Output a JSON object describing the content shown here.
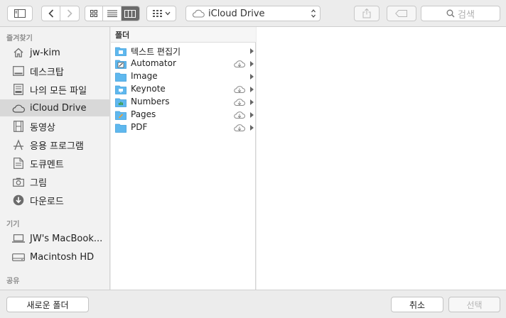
{
  "toolbar": {
    "path_label": "iCloud Drive",
    "search_placeholder": "검색"
  },
  "sidebar": {
    "sections": [
      {
        "label": "즐겨찾기"
      },
      {
        "label": "기기"
      },
      {
        "label": "공유"
      }
    ],
    "favorites": [
      {
        "label": "jw-kim",
        "icon": "home-icon"
      },
      {
        "label": "데스크탑",
        "icon": "desktop-icon"
      },
      {
        "label": "나의 모든 파일",
        "icon": "all-files-icon"
      },
      {
        "label": "iCloud Drive",
        "icon": "cloud-icon",
        "selected": true
      },
      {
        "label": "동영상",
        "icon": "film-icon"
      },
      {
        "label": "응용 프로그램",
        "icon": "applications-icon"
      },
      {
        "label": "도큐멘트",
        "icon": "document-icon"
      },
      {
        "label": "그림",
        "icon": "camera-icon"
      },
      {
        "label": "다운로드",
        "icon": "download-icon"
      }
    ],
    "devices": [
      {
        "label": "JW's MacBook...",
        "icon": "laptop-icon"
      },
      {
        "label": "Macintosh HD",
        "icon": "disk-icon"
      }
    ]
  },
  "column": {
    "header": "폴더",
    "items": [
      {
        "name": "텍스트 편집기",
        "cloud": false
      },
      {
        "name": "Automator",
        "cloud": true
      },
      {
        "name": "Image",
        "cloud": false
      },
      {
        "name": "Keynote",
        "cloud": true
      },
      {
        "name": "Numbers",
        "cloud": true
      },
      {
        "name": "Pages",
        "cloud": true
      },
      {
        "name": "PDF",
        "cloud": true
      }
    ]
  },
  "bottom": {
    "new_folder": "새로운 폴더",
    "cancel": "취소",
    "choose": "선택"
  },
  "colors": {
    "folder": "#5fb8ee",
    "selected_bg": "#d8d8d8",
    "window_bg": "#ececec"
  }
}
